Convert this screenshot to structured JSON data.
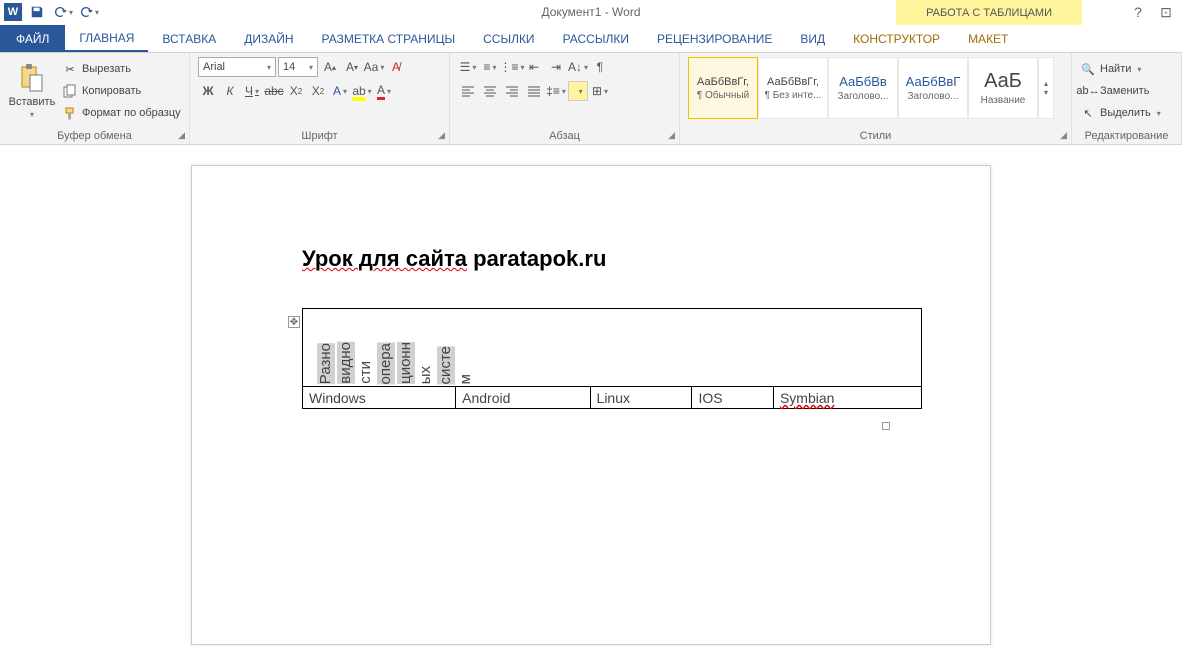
{
  "titlebar": {
    "app_icon_letter": "W",
    "doc_title": "Документ1 - Word",
    "table_tools": "РАБОТА С ТАБЛИЦАМИ"
  },
  "tabs": {
    "file": "ФАЙЛ",
    "home": "ГЛАВНАЯ",
    "insert": "ВСТАВКА",
    "design": "ДИЗАЙН",
    "layout": "РАЗМЕТКА СТРАНИЦЫ",
    "references": "ССЫЛКИ",
    "mailings": "РАССЫЛКИ",
    "review": "РЕЦЕНЗИРОВАНИЕ",
    "view": "ВИД",
    "constructor": "КОНСТРУКТОР",
    "tlayout": "МАКЕТ"
  },
  "clipboard": {
    "paste": "Вставить",
    "cut": "Вырезать",
    "copy": "Копировать",
    "format_painter": "Формат по образцу",
    "group": "Буфер обмена"
  },
  "font": {
    "name": "Arial",
    "size": "14",
    "group": "Шрифт"
  },
  "paragraph": {
    "group": "Абзац"
  },
  "styles": {
    "group": "Стили",
    "items": [
      {
        "preview": "АаБбВвГг,",
        "name": "¶ Обычный",
        "cls": ""
      },
      {
        "preview": "АаБбВвГг,",
        "name": "¶ Без инте...",
        "cls": ""
      },
      {
        "preview": "АаБбВв",
        "name": "Заголово...",
        "cls": "blue"
      },
      {
        "preview": "АаБбВвГ",
        "name": "Заголово...",
        "cls": "blue"
      },
      {
        "preview": "АаБ",
        "name": "Название",
        "cls": "big"
      }
    ]
  },
  "editing": {
    "find": "Найти",
    "replace": "Заменить",
    "select": "Выделить",
    "group": "Редактирование"
  },
  "document": {
    "heading_u": "Урок для сайта",
    "heading_plain": " paratapok.ru",
    "table": {
      "header_rotated": [
        "Разно",
        "видно",
        "сти",
        "опера",
        "ционн",
        "ых",
        "систе",
        "м"
      ],
      "row2": [
        "Windows",
        "Android",
        "Linux",
        "IOS",
        "Symbian"
      ]
    }
  }
}
